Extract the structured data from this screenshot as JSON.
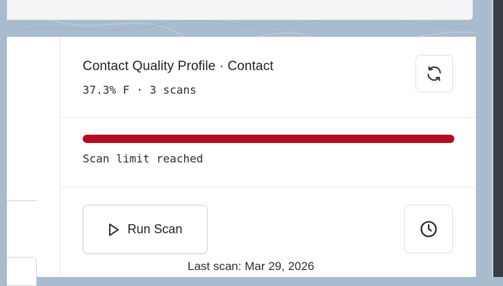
{
  "card": {
    "title": "Contact Quality Profile · Contact",
    "summary": "37.3% F · 3 scans",
    "scan_limit_progress": 1.0,
    "status_text": "Scan limit reached",
    "run_button_label": "Run Scan",
    "last_scan_text": "Last scan: Mar 29, 2026"
  },
  "icons": {
    "refresh": "refresh-icon",
    "run": "play-icon",
    "history": "clock-icon"
  },
  "colors": {
    "progress_fill": "#b5091f",
    "progress_track": "#e7e8ea",
    "background": "#a9bccd"
  }
}
